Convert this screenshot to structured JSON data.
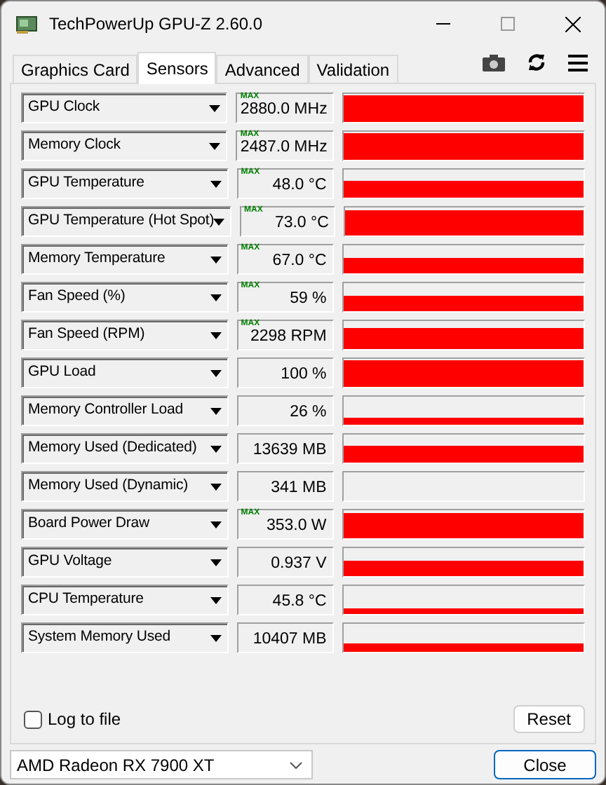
{
  "window": {
    "title": "TechPowerUp GPU-Z 2.60.0"
  },
  "tabs": [
    {
      "label": "Graphics Card",
      "selected": false
    },
    {
      "label": "Sensors",
      "selected": true
    },
    {
      "label": "Advanced",
      "selected": false
    },
    {
      "label": "Validation",
      "selected": false
    }
  ],
  "sensors": [
    {
      "name": "GPU Clock",
      "max_label": "MAX",
      "value": "2880.0 MHz"
    },
    {
      "name": "Memory Clock",
      "max_label": "MAX",
      "value": "2487.0 MHz"
    },
    {
      "name": "GPU Temperature",
      "max_label": "MAX",
      "value": "48.0 °C"
    },
    {
      "name": "GPU Temperature (Hot Spot)",
      "max_label": "MAX",
      "value": "73.0 °C"
    },
    {
      "name": "Memory Temperature",
      "max_label": "MAX",
      "value": "67.0 °C"
    },
    {
      "name": "Fan Speed (%)",
      "max_label": "MAX",
      "value": "59 %"
    },
    {
      "name": "Fan Speed (RPM)",
      "max_label": "MAX",
      "value": "2298 RPM"
    },
    {
      "name": "GPU Load",
      "value": "100 %"
    },
    {
      "name": "Memory Controller Load",
      "value": "26 %"
    },
    {
      "name": "Memory Used (Dedicated)",
      "value": "13639 MB"
    },
    {
      "name": "Memory Used (Dynamic)",
      "value": "341 MB"
    },
    {
      "name": "Board Power Draw",
      "max_label": "MAX",
      "value": "353.0 W"
    },
    {
      "name": "GPU Voltage",
      "value": "0.937 V"
    },
    {
      "name": "CPU Temperature",
      "value": "45.8 °C"
    },
    {
      "name": "System Memory Used",
      "value": "10407 MB"
    }
  ],
  "log_to_file": {
    "label": "Log to file",
    "checked": false
  },
  "reset_button": "Reset",
  "gpu_select": {
    "value": "AMD Radeon RX 7900 XT"
  },
  "close_button": "Close"
}
